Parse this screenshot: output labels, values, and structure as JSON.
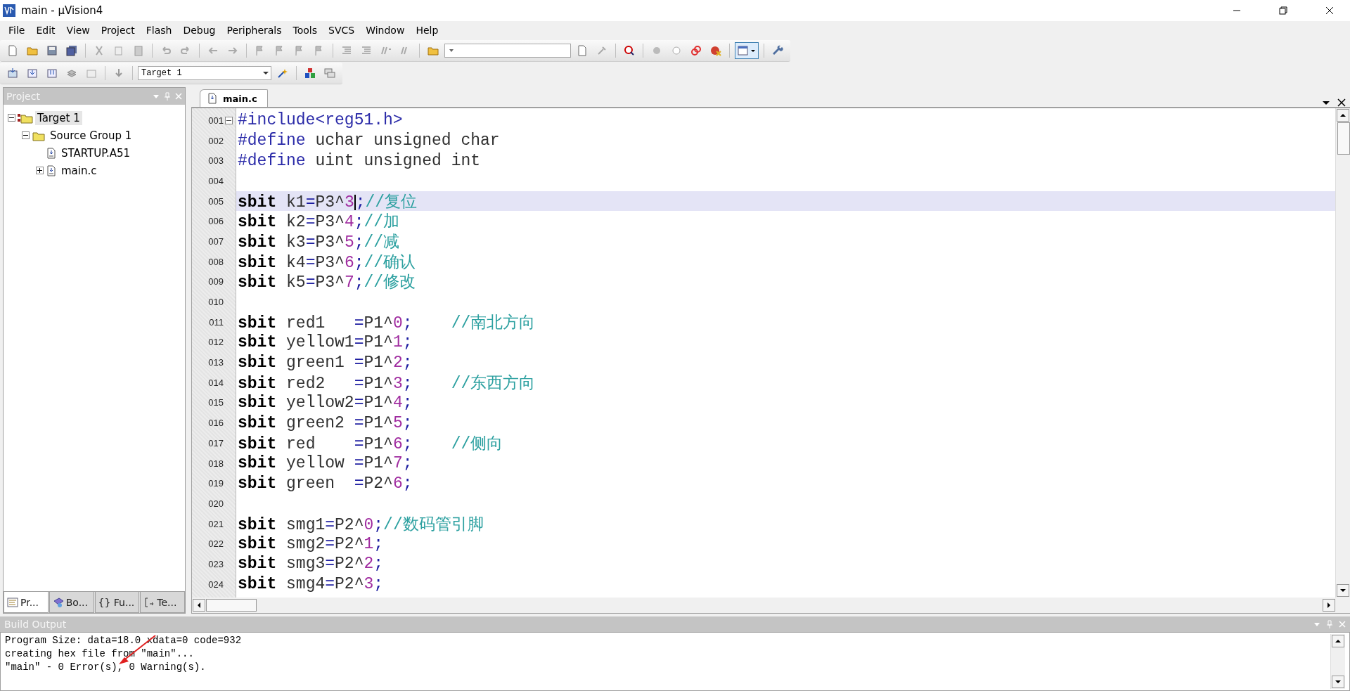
{
  "window": {
    "title": "main  - µVision4"
  },
  "menu": [
    "File",
    "Edit",
    "View",
    "Project",
    "Flash",
    "Debug",
    "Peripherals",
    "Tools",
    "SVCS",
    "Window",
    "Help"
  ],
  "toolbar": {
    "target": "Target 1"
  },
  "project_panel": {
    "title": "Project",
    "tree": [
      {
        "label": "Target 1",
        "kind": "target",
        "selected": true,
        "expanded": true,
        "children": [
          {
            "label": "Source Group 1",
            "kind": "group",
            "selected": false,
            "expanded": true,
            "children": [
              {
                "label": "STARTUP.A51",
                "kind": "file",
                "selected": false
              },
              {
                "label": "main.c",
                "kind": "file",
                "selected": false,
                "expanded": false
              }
            ]
          }
        ]
      }
    ],
    "tabs": [
      {
        "label": "Pr...",
        "kind": "project",
        "selected": true
      },
      {
        "label": "Bo...",
        "kind": "books",
        "selected": false
      },
      {
        "label": "{} Fu...",
        "kind": "functions",
        "selected": false
      },
      {
        "label": "Te...",
        "kind": "templates",
        "selected": false
      }
    ]
  },
  "editor": {
    "tab": "main.c",
    "lines": [
      {
        "n": "001",
        "fold": true,
        "current": false,
        "tokens": [
          {
            "kind": "pp",
            "text": "#include<reg51.h>"
          }
        ]
      },
      {
        "n": "002",
        "fold": false,
        "current": false,
        "tokens": [
          {
            "kind": "pp",
            "text": "#define"
          },
          {
            "kind": "id",
            "text": " uchar unsigned char"
          }
        ]
      },
      {
        "n": "003",
        "fold": false,
        "current": false,
        "tokens": [
          {
            "kind": "pp",
            "text": "#define"
          },
          {
            "kind": "id",
            "text": " uint unsigned int"
          }
        ]
      },
      {
        "n": "004",
        "fold": false,
        "current": false
      },
      {
        "n": "005",
        "fold": false,
        "current": true,
        "tokens": [
          {
            "kind": "kw",
            "text": "sbit"
          },
          {
            "kind": "id",
            "text": " k1"
          },
          {
            "kind": "op",
            "text": "="
          },
          {
            "kind": "id",
            "text": "P3^"
          },
          {
            "kind": "num",
            "text": "3"
          },
          {
            "kind": "op",
            "text": ";"
          },
          {
            "kind": "cm",
            "text": "//复位"
          }
        ]
      },
      {
        "n": "006",
        "fold": false,
        "current": false,
        "tokens": [
          {
            "kind": "kw",
            "text": "sbit"
          },
          {
            "kind": "id",
            "text": " k2"
          },
          {
            "kind": "op",
            "text": "="
          },
          {
            "kind": "id",
            "text": "P3^"
          },
          {
            "kind": "num",
            "text": "4"
          },
          {
            "kind": "op",
            "text": ";"
          },
          {
            "kind": "cm",
            "text": "//加"
          }
        ]
      },
      {
        "n": "007",
        "fold": false,
        "current": false,
        "tokens": [
          {
            "kind": "kw",
            "text": "sbit"
          },
          {
            "kind": "id",
            "text": " k3"
          },
          {
            "kind": "op",
            "text": "="
          },
          {
            "kind": "id",
            "text": "P3^"
          },
          {
            "kind": "num",
            "text": "5"
          },
          {
            "kind": "op",
            "text": ";"
          },
          {
            "kind": "cm",
            "text": "//减"
          }
        ]
      },
      {
        "n": "008",
        "fold": false,
        "current": false,
        "tokens": [
          {
            "kind": "kw",
            "text": "sbit"
          },
          {
            "kind": "id",
            "text": " k4"
          },
          {
            "kind": "op",
            "text": "="
          },
          {
            "kind": "id",
            "text": "P3^"
          },
          {
            "kind": "num",
            "text": "6"
          },
          {
            "kind": "op",
            "text": ";"
          },
          {
            "kind": "cm",
            "text": "//确认"
          }
        ]
      },
      {
        "n": "009",
        "fold": false,
        "current": false,
        "tokens": [
          {
            "kind": "kw",
            "text": "sbit"
          },
          {
            "kind": "id",
            "text": " k5"
          },
          {
            "kind": "op",
            "text": "="
          },
          {
            "kind": "id",
            "text": "P3^"
          },
          {
            "kind": "num",
            "text": "7"
          },
          {
            "kind": "op",
            "text": ";"
          },
          {
            "kind": "cm",
            "text": "//修改"
          }
        ]
      },
      {
        "n": "010",
        "fold": false,
        "current": false
      },
      {
        "n": "011",
        "fold": false,
        "current": false,
        "tokens": [
          {
            "kind": "kw",
            "text": "sbit"
          },
          {
            "kind": "id",
            "text": " red1   "
          },
          {
            "kind": "op",
            "text": "="
          },
          {
            "kind": "id",
            "text": "P1^"
          },
          {
            "kind": "num",
            "text": "0"
          },
          {
            "kind": "op",
            "text": ";"
          },
          {
            "kind": "cm",
            "text": "    //南北方向"
          }
        ]
      },
      {
        "n": "012",
        "fold": false,
        "current": false,
        "tokens": [
          {
            "kind": "kw",
            "text": "sbit"
          },
          {
            "kind": "id",
            "text": " yellow1"
          },
          {
            "kind": "op",
            "text": "="
          },
          {
            "kind": "id",
            "text": "P1^"
          },
          {
            "kind": "num",
            "text": "1"
          },
          {
            "kind": "op",
            "text": ";"
          }
        ]
      },
      {
        "n": "013",
        "fold": false,
        "current": false,
        "tokens": [
          {
            "kind": "kw",
            "text": "sbit"
          },
          {
            "kind": "id",
            "text": " green1 "
          },
          {
            "kind": "op",
            "text": "="
          },
          {
            "kind": "id",
            "text": "P1^"
          },
          {
            "kind": "num",
            "text": "2"
          },
          {
            "kind": "op",
            "text": ";"
          }
        ]
      },
      {
        "n": "014",
        "fold": false,
        "current": false,
        "tokens": [
          {
            "kind": "kw",
            "text": "sbit"
          },
          {
            "kind": "id",
            "text": " red2   "
          },
          {
            "kind": "op",
            "text": "="
          },
          {
            "kind": "id",
            "text": "P1^"
          },
          {
            "kind": "num",
            "text": "3"
          },
          {
            "kind": "op",
            "text": ";"
          },
          {
            "kind": "cm",
            "text": "    //东西方向"
          }
        ]
      },
      {
        "n": "015",
        "fold": false,
        "current": false,
        "tokens": [
          {
            "kind": "kw",
            "text": "sbit"
          },
          {
            "kind": "id",
            "text": " yellow2"
          },
          {
            "kind": "op",
            "text": "="
          },
          {
            "kind": "id",
            "text": "P1^"
          },
          {
            "kind": "num",
            "text": "4"
          },
          {
            "kind": "op",
            "text": ";"
          }
        ]
      },
      {
        "n": "016",
        "fold": false,
        "current": false,
        "tokens": [
          {
            "kind": "kw",
            "text": "sbit"
          },
          {
            "kind": "id",
            "text": " green2 "
          },
          {
            "kind": "op",
            "text": "="
          },
          {
            "kind": "id",
            "text": "P1^"
          },
          {
            "kind": "num",
            "text": "5"
          },
          {
            "kind": "op",
            "text": ";"
          }
        ]
      },
      {
        "n": "017",
        "fold": false,
        "current": false,
        "tokens": [
          {
            "kind": "kw",
            "text": "sbit"
          },
          {
            "kind": "id",
            "text": " red    "
          },
          {
            "kind": "op",
            "text": "="
          },
          {
            "kind": "id",
            "text": "P1^"
          },
          {
            "kind": "num",
            "text": "6"
          },
          {
            "kind": "op",
            "text": ";"
          },
          {
            "kind": "cm",
            "text": "    //侧向"
          }
        ]
      },
      {
        "n": "018",
        "fold": false,
        "current": false,
        "tokens": [
          {
            "kind": "kw",
            "text": "sbit"
          },
          {
            "kind": "id",
            "text": " yellow "
          },
          {
            "kind": "op",
            "text": "="
          },
          {
            "kind": "id",
            "text": "P1^"
          },
          {
            "kind": "num",
            "text": "7"
          },
          {
            "kind": "op",
            "text": ";"
          }
        ]
      },
      {
        "n": "019",
        "fold": false,
        "current": false,
        "tokens": [
          {
            "kind": "kw",
            "text": "sbit"
          },
          {
            "kind": "id",
            "text": " green  "
          },
          {
            "kind": "op",
            "text": "="
          },
          {
            "kind": "id",
            "text": "P2^"
          },
          {
            "kind": "num",
            "text": "6"
          },
          {
            "kind": "op",
            "text": ";"
          }
        ]
      },
      {
        "n": "020",
        "fold": false,
        "current": false
      },
      {
        "n": "021",
        "fold": false,
        "current": false,
        "tokens": [
          {
            "kind": "kw",
            "text": "sbit"
          },
          {
            "kind": "id",
            "text": " smg1"
          },
          {
            "kind": "op",
            "text": "="
          },
          {
            "kind": "id",
            "text": "P2^"
          },
          {
            "kind": "num",
            "text": "0"
          },
          {
            "kind": "op",
            "text": ";"
          },
          {
            "kind": "cm",
            "text": "//数码管引脚"
          }
        ]
      },
      {
        "n": "022",
        "fold": false,
        "current": false,
        "tokens": [
          {
            "kind": "kw",
            "text": "sbit"
          },
          {
            "kind": "id",
            "text": " smg2"
          },
          {
            "kind": "op",
            "text": "="
          },
          {
            "kind": "id",
            "text": "P2^"
          },
          {
            "kind": "num",
            "text": "1"
          },
          {
            "kind": "op",
            "text": ";"
          }
        ]
      },
      {
        "n": "023",
        "fold": false,
        "current": false,
        "tokens": [
          {
            "kind": "kw",
            "text": "sbit"
          },
          {
            "kind": "id",
            "text": " smg3"
          },
          {
            "kind": "op",
            "text": "="
          },
          {
            "kind": "id",
            "text": "P2^"
          },
          {
            "kind": "num",
            "text": "2"
          },
          {
            "kind": "op",
            "text": ";"
          }
        ]
      },
      {
        "n": "024",
        "fold": false,
        "current": false,
        "tokens": [
          {
            "kind": "kw",
            "text": "sbit"
          },
          {
            "kind": "id",
            "text": " smg4"
          },
          {
            "kind": "op",
            "text": "="
          },
          {
            "kind": "id",
            "text": "P2^"
          },
          {
            "kind": "num",
            "text": "3"
          },
          {
            "kind": "op",
            "text": ";"
          }
        ]
      }
    ]
  },
  "build_output": {
    "title": "Build Output",
    "lines": [
      "Program Size: data=18.0 xdata=0 code=932",
      "creating hex file from \"main\"...",
      "\"main\" - 0 Error(s), 0 Warning(s)."
    ]
  }
}
